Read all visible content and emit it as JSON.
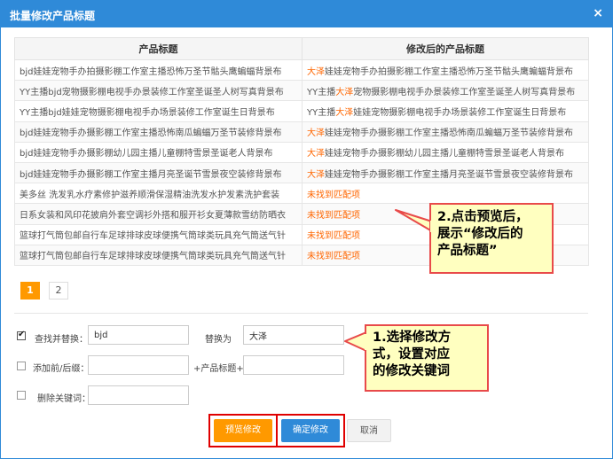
{
  "dialog": {
    "title": "批量修改产品标题",
    "close_glyph": "×"
  },
  "table": {
    "headers": [
      "产品标题",
      "修改后的产品标题"
    ],
    "rows": [
      {
        "orig": "bjd娃娃宠物手办拍摄影棚工作室主播恐怖万圣节骷头鹰蝙蝠背景布",
        "pre": "",
        "hl": "大泽",
        "post": "娃娃宠物手办拍摄影棚工作室主播恐怖万圣节骷头鹰蝙蝠背景布"
      },
      {
        "orig": "YY主播bjd宠物摄影棚电视手办景装修工作室圣诞圣人树写真背景布",
        "pre": "YY主播",
        "hl": "大泽",
        "post": "宠物摄影棚电视手办景装修工作室圣诞圣人树写真背景布"
      },
      {
        "orig": "YY主播bjd娃娃宠物摄影棚电视手办场景装修工作室诞生日背景布",
        "pre": "YY主播",
        "hl": "大泽",
        "post": "娃娃宠物摄影棚电视手办场景装修工作室诞生日背景布"
      },
      {
        "orig": "bjd娃娃宠物手办摄影棚工作室主播恐怖南瓜蝙蝠万圣节装修背景布",
        "pre": "",
        "hl": "大泽",
        "post": "娃娃宠物手办摄影棚工作室主播恐怖南瓜蝙蝠万圣节装修背景布"
      },
      {
        "orig": "bjd娃娃宠物手办摄影棚幼儿园主播儿童棚特雪景圣诞老人背景布",
        "pre": "",
        "hl": "大泽",
        "post": "娃娃宠物手办摄影棚幼儿园主播儿童棚特雪景圣诞老人背景布"
      },
      {
        "orig": "bjd娃娃宠物手办摄影棚工作室主播月亮圣诞节雪景夜空装修背景布",
        "pre": "",
        "hl": "大泽",
        "post": "娃娃宠物手办摄影棚工作室主播月亮圣诞节雪景夜空装修背景布"
      },
      {
        "orig": "美多丝 洗发乳水疗素修护滋养顺滑保湿精油洗发水护发素洗护套装",
        "notfound": "未找到匹配项"
      },
      {
        "orig": "日系女装和风印花披肩外套空调衫外搭和服开衫女夏薄款雪纺防晒衣",
        "notfound": "未找到匹配项"
      },
      {
        "orig": "篮球打气筒包邮自行车足球排球皮球便携气筒球类玩具充气筒送气针",
        "notfound": "未找到匹配项"
      },
      {
        "orig": "篮球打气筒包邮自行车足球排球皮球便携气筒球类玩具充气筒送气针",
        "notfound": "未找到匹配项"
      }
    ]
  },
  "pagination": {
    "pages": [
      "1",
      "2"
    ],
    "current": "1"
  },
  "form": {
    "find_replace": {
      "checked": true,
      "label": "查找并替换：",
      "find_value": "bjd",
      "replace_label": "替换为",
      "replace_value": "大泽"
    },
    "prefix_suffix": {
      "checked": false,
      "label": "添加前/后缀：",
      "plus_label": "+产品标题+",
      "prefix_value": "",
      "suffix_value": ""
    },
    "delete_keyword": {
      "checked": false,
      "label": "删除关键词：",
      "value": ""
    }
  },
  "buttons": {
    "preview": "预览修改",
    "confirm": "确定修改",
    "cancel": "取消"
  },
  "annotations": {
    "callout_preview": "2.点击预览后，\n展示“修改后的\n产品标题”",
    "callout_options": "1.选择修改方\n式，设置对应\n的修改关键词"
  },
  "colors": {
    "primary_blue": "#2f8ad8",
    "accent_orange": "#ff9900",
    "highlight_text": "#ff6600",
    "callout_bg": "#ffffc0",
    "annotation_red": "#e00000"
  }
}
